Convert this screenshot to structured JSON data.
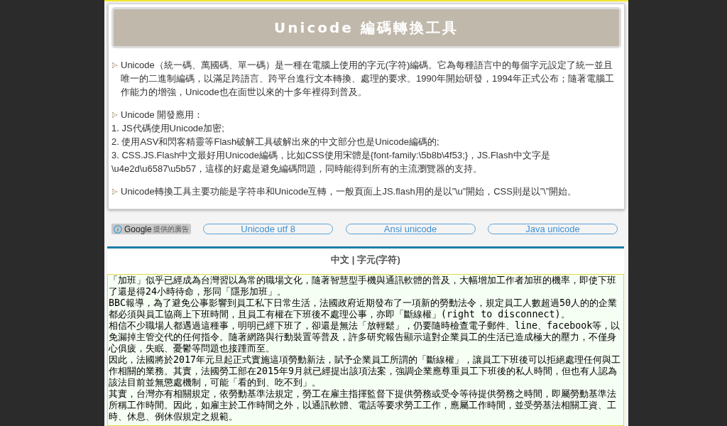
{
  "header": {
    "title": "Unicode 編碼轉換工具"
  },
  "sections": [
    {
      "kind": "paragraph",
      "text": "Unicode（統一碼、萬國碼、單一碼）是一種在電腦上使用的字元(字符)編碼。它為每種語言中的每個字元設定了統一並且唯一的二進制編碼，以滿足跨語言、跨平台進行文本轉換、處理的要求。1990年開始研發，1994年正式公布；隨著電腦工作能力的增強，Unicode也在面世以來的十多年裡得到普及。"
    },
    {
      "kind": "list",
      "heading": "Unicode 開發應用：",
      "items": [
        "1. JS代碼使用Unicode加密;",
        "2. 使用ASV和閃客精靈等Flash破解工具破解出來的中文部分也是Unicode編碼的;",
        "3. CSS.JS.Flash中文最好用Unicode編碼，比如CSS使用宋體是{font-family:\\5b8b\\4f53;}，JS.Flash中文字是\\u4e2d\\u6587\\u5b57，這樣的好處是避免編碼問題，同時能得到所有的主流瀏覽器的支持。"
      ]
    },
    {
      "kind": "paragraph",
      "text": "Unicode轉換工具主要功能是字符串和Unicode互轉，一般頁面上JS.flash用的是以”\\u”開始，CSS則是以”\\”開始。"
    }
  ],
  "ads": {
    "brand": "Google",
    "note": "提供的廣告",
    "links": [
      "Unicode utf 8",
      "Ansi unicode",
      "Java unicode"
    ]
  },
  "converter": {
    "heading": "中文 | 字元(字符)",
    "paragraphs": [
      "「加班」似乎已經成為台灣習以為常的職場文化，隨著智慧型手機與通訊軟體的普及，大幅增加工作者加班的機率，即使下班了還是得24小時待命，形同「隱形加班」。",
      "BBC報導，為了避免公事影響到員工私下日常生活，法國政府近期發布了一項新的勞動法令，規定員工人數超過50人的的企業都必須與員工協商上下班時間，且員工有權在下班後不處理公事，亦即「斷線權」(right to disconnect)。",
      "相信不少職場人都遇過這種事，明明已經下班了，卻還是無法「放輕鬆」，仍要隨時檢查電子郵件、line、facebook等，以免漏掉主管交代的任何指令。隨著網路與行動裝置等普及，許多研究報告顯示這對企業員工的生活已造成極大的壓力，不僅身心俱疲，失眠、憂鬱等問題也接踵而至。",
      "因此，法國將於2017年元旦起正式實施這項勞動新法，賦予企業員工所謂的「斷線權」，讓員工下班後可以拒絕處理任何與工作相關的業務。其實，法國勞工部在2015年9月就已經提出該項法案，強調企業應尊重員工下班後的私人時間，但也有人認為該法目前並無懲處機制，可能「看的到、吃不到」。",
      "其實，台灣亦有相關規定，依勞動基準法規定，勞工在雇主指揮監督下提供勞務或受令等待提供勞務之時間，即屬勞動基準法所稱工作時間。因此，如雇主於工作時間之外，以通訊軟體、電話等要求勞工工作，應屬工作時間，並受勞基法相關工資、工時、休息、例休假規定之規範。"
    ]
  }
}
